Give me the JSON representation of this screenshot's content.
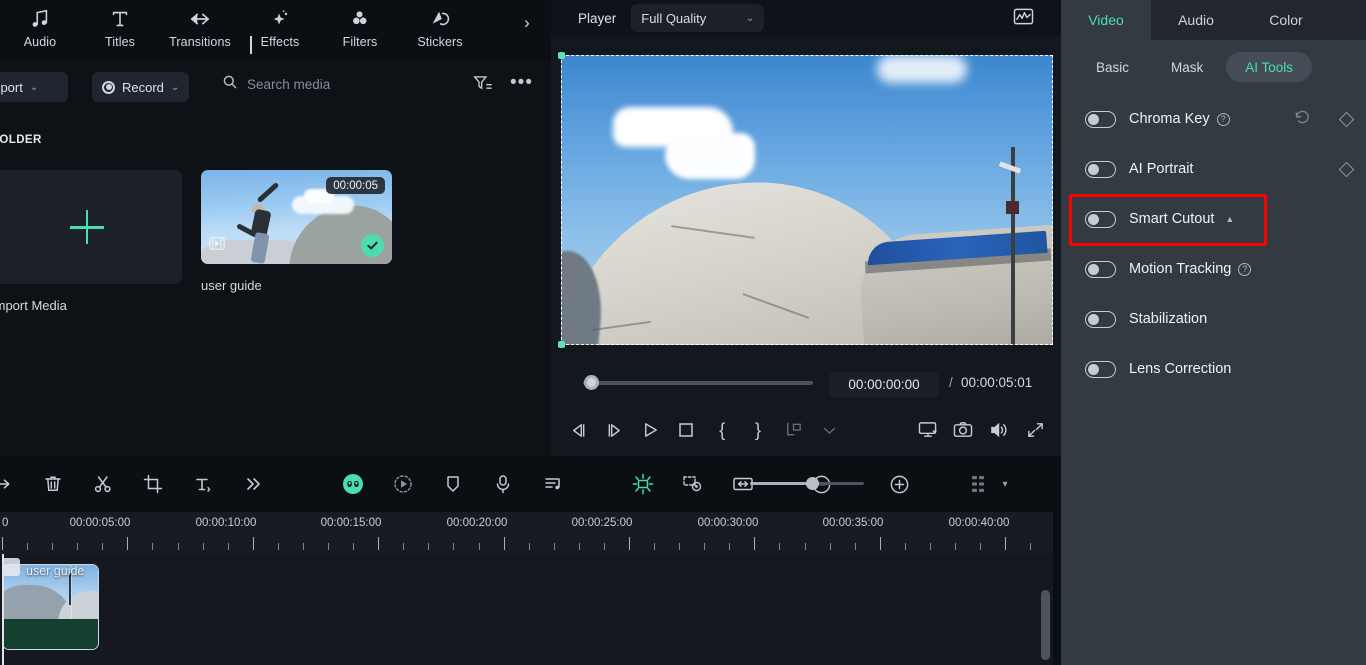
{
  "nav": {
    "items": [
      {
        "label": "Audio",
        "icon": "music-note-icon"
      },
      {
        "label": "Titles",
        "icon": "text-t-icon"
      },
      {
        "label": "Transitions",
        "icon": "transitions-arrows-icon"
      },
      {
        "label": "Effects",
        "icon": "sparkle-star-icon"
      },
      {
        "label": "Filters",
        "icon": "three-circles-icon"
      },
      {
        "label": "Stickers",
        "icon": "sticker-icon"
      }
    ],
    "expand": "›"
  },
  "media_toolbar": {
    "import_label": "Import",
    "import_caret": "⌄",
    "record_label": "Record",
    "record_caret": "⌄",
    "search_placeholder": "Search media",
    "search_value": "",
    "filter_icon": "filter-icon",
    "more_label": "•••"
  },
  "media": {
    "folder_label": "FOLDER",
    "import_tile_label": "Import Media",
    "clips": [
      {
        "name": "user guide",
        "duration": "00:00:05",
        "selected": true
      }
    ]
  },
  "player": {
    "label": "Player",
    "quality": "Full Quality",
    "quality_caret": "⌄",
    "waveform_icon": "waveform-monitor-icon",
    "current_time": "00:00:00:00",
    "separator": "/",
    "total_time": "00:00:05:01",
    "transport": [
      {
        "name": "prev-frame-button",
        "glyph": "◁|"
      },
      {
        "name": "next-frame-button",
        "glyph": "|▷"
      },
      {
        "name": "play-button",
        "glyph": "▷"
      },
      {
        "name": "stop-button",
        "glyph": "□"
      },
      {
        "name": "mark-in-button",
        "glyph": "{"
      },
      {
        "name": "mark-out-button",
        "glyph": "}"
      },
      {
        "name": "export-frame-button",
        "glyph": "⇱"
      },
      {
        "name": "transport-dropdown",
        "glyph": "⌄"
      },
      {
        "name": "display-settings-button",
        "glyph": "▣"
      },
      {
        "name": "snapshot-button",
        "glyph": "◙"
      },
      {
        "name": "volume-button",
        "glyph": "◁)"
      },
      {
        "name": "fullscreen-button",
        "glyph": "⤢"
      }
    ]
  },
  "right_panel": {
    "tabs": [
      {
        "label": "Video",
        "active": true
      },
      {
        "label": "Audio",
        "active": false
      },
      {
        "label": "Color",
        "active": false
      }
    ],
    "sub_tabs": [
      {
        "label": "Basic",
        "active": false
      },
      {
        "label": "Mask",
        "active": false
      },
      {
        "label": "AI Tools",
        "active": true
      }
    ],
    "tools": [
      {
        "label": "Chroma Key",
        "enabled": false,
        "help": true,
        "caret": false,
        "reset": true,
        "keyframe": true
      },
      {
        "label": "AI Portrait",
        "enabled": false,
        "help": false,
        "caret": false,
        "reset": false,
        "keyframe": true
      },
      {
        "label": "Smart Cutout",
        "enabled": false,
        "help": false,
        "caret": true,
        "reset": false,
        "keyframe": false,
        "highlighted": true
      },
      {
        "label": "Motion Tracking",
        "enabled": false,
        "help": true,
        "caret": false,
        "reset": false,
        "keyframe": false
      },
      {
        "label": "Stabilization",
        "enabled": false,
        "help": false,
        "caret": false,
        "reset": false,
        "keyframe": false
      },
      {
        "label": "Lens Correction",
        "enabled": false,
        "help": false,
        "caret": false,
        "reset": false,
        "keyframe": false
      }
    ],
    "highlight_color": "#fe0000",
    "accent_color": "#4ddcaf"
  },
  "timeline": {
    "toolbar_left": [
      {
        "name": "undo-redo-icon",
        "glyph": "⇨"
      },
      {
        "name": "delete-icon",
        "glyph": "trash"
      },
      {
        "name": "split-scissors-icon",
        "glyph": "scissors"
      },
      {
        "name": "crop-icon",
        "glyph": "crop"
      },
      {
        "name": "text-icon",
        "glyph": "T"
      },
      {
        "name": "more-tools-icon",
        "glyph": "»"
      }
    ],
    "toolbar_mid": [
      {
        "name": "ai-avatar-icon",
        "glyph": "avatar"
      },
      {
        "name": "speed-ramp-icon",
        "glyph": "speed"
      },
      {
        "name": "marker-icon",
        "glyph": "marker"
      },
      {
        "name": "record-voiceover-icon",
        "glyph": "mic"
      },
      {
        "name": "audio-detach-icon",
        "glyph": "audio-list"
      }
    ],
    "toolbar_right": [
      {
        "name": "auto-highlight-icon",
        "glyph": "sparkle"
      },
      {
        "name": "green-screen-icon",
        "glyph": "screen"
      },
      {
        "name": "fit-to-timeline-icon",
        "glyph": "fit"
      }
    ],
    "zoom_out_label": "−",
    "zoom_in_label": "+",
    "zoom_value": 50,
    "grid_icon": "grid-icon",
    "grid_caret": "▾",
    "ruler_labels": [
      "00:00:05:00",
      "00:00:10:00",
      "00:00:15:00",
      "00:00:20:00",
      "00:00:25:00",
      "00:00:30:00",
      "00:00:35:00",
      "00:00:40:00"
    ],
    "ruler_start_label": "0",
    "clip": {
      "name": "user guide"
    }
  }
}
